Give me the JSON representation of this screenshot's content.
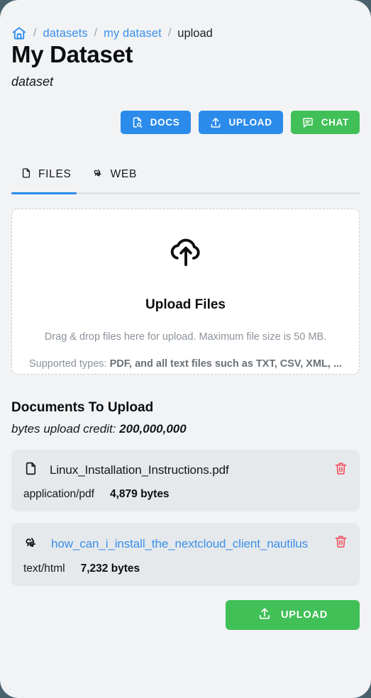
{
  "breadcrumb": {
    "home_icon": "home-icon",
    "separator": "/",
    "items": [
      {
        "label": "datasets",
        "type": "link"
      },
      {
        "label": "my dataset",
        "type": "link"
      },
      {
        "label": "upload",
        "type": "current"
      }
    ]
  },
  "header": {
    "title": "My Dataset",
    "subtitle": "dataset"
  },
  "actions": [
    {
      "label": "DOCS",
      "icon": "document-search-icon",
      "color": "#2b8bea"
    },
    {
      "label": "UPLOAD",
      "icon": "upload-icon",
      "color": "#2b8bea"
    },
    {
      "label": "CHAT",
      "icon": "chat-bubble-icon",
      "color": "#40c057"
    }
  ],
  "tabs": [
    {
      "label": "FILES",
      "icon": "file-icon",
      "active": true
    },
    {
      "label": "WEB",
      "icon": "webhook-icon",
      "active": false
    }
  ],
  "dropzone": {
    "icon": "cloud-upload-icon",
    "title": "Upload Files",
    "line1": "Drag & drop files here for upload. Maximum file size is 50 MB.",
    "line2_prefix": "Supported types: ",
    "line2_bold": "PDF, and all text files such as TXT, CSV, XML, ..."
  },
  "documents": {
    "heading": "Documents To Upload",
    "credit_label": "bytes upload credit: ",
    "credit_value": "200,000,000",
    "files": [
      {
        "icon": "file-icon",
        "name": "Linux_Installation_Instructions.pdf",
        "is_link": false,
        "type": "application/pdf",
        "size": "4,879 bytes",
        "delete_icon": "trash-icon"
      },
      {
        "icon": "webhook-icon",
        "name": "how_can_i_install_the_nextcloud_client_nautilus",
        "is_link": true,
        "type": "text/html",
        "size": "7,232 bytes",
        "delete_icon": "trash-icon"
      }
    ]
  },
  "footer": {
    "upload_label": "UPLOAD",
    "upload_icon": "upload-icon",
    "color": "#40c057"
  },
  "colors": {
    "page_background": "#f1f3f5",
    "outer_background": "#4a626e",
    "accent_blue": "#2b8bea",
    "link_blue": "#3b8fe8",
    "accent_green": "#40c057",
    "danger_red": "#f4525c",
    "row_background": "#e5e9ec",
    "muted_text": "#8b939b"
  }
}
